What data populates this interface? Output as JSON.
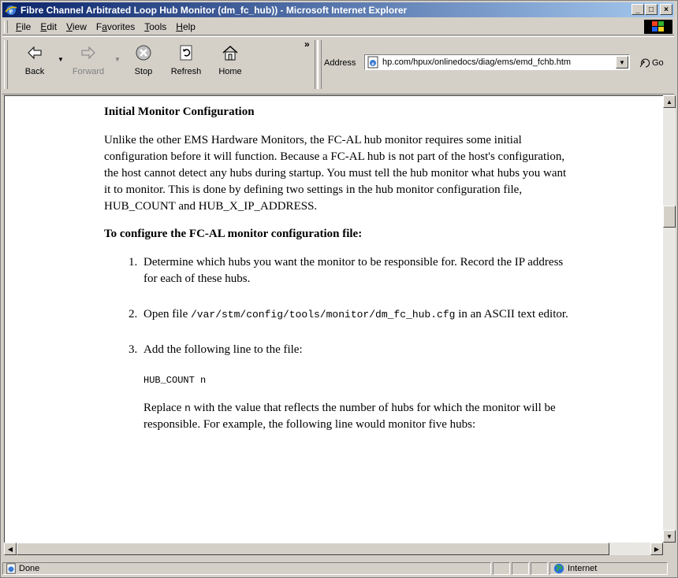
{
  "window": {
    "title": "Fibre Channel Arbitrated Loop Hub Monitor (dm_fc_hub)) - Microsoft Internet Explorer",
    "minimize": "_",
    "maximize": "□",
    "close": "×"
  },
  "menu": {
    "items": [
      {
        "key": "F",
        "rest": "ile"
      },
      {
        "key": "E",
        "rest": "dit"
      },
      {
        "key": "V",
        "rest": "iew"
      },
      {
        "key": "a",
        "pre": "F",
        "rest": "vorites"
      },
      {
        "key": "T",
        "rest": "ools"
      },
      {
        "key": "H",
        "rest": "elp"
      }
    ]
  },
  "toolbar": {
    "back": "Back",
    "forward": "Forward",
    "stop": "Stop",
    "refresh": "Refresh",
    "home": "Home",
    "more": "»",
    "address_label": "Address",
    "address_value": "hp.com/hpux/onlinedocs/diag/ems/emd_fchb.htm",
    "go": "Go"
  },
  "doc": {
    "heading": "Initial Monitor Configuration",
    "intro": "Unlike the other EMS Hardware Monitors, the FC-AL hub monitor requires some initial configuration before it will function. Because a FC-AL hub is not part of the host's configuration, the host cannot detect any hubs during startup. You must tell the hub monitor what hubs you want it to monitor. This is done by defining two settings in the hub monitor configuration file, HUB_COUNT and HUB_X_IP_ADDRESS.",
    "subheading": "To configure the FC-AL monitor configuration file:",
    "steps": {
      "s1": "Determine which hubs you want the monitor to be responsible for. Record the IP address for each of these hubs.",
      "s2_pre": "Open file ",
      "s2_code": "/var/stm/config/tools/monitor/dm_fc_hub.cfg",
      "s2_post": " in an ASCII text editor.",
      "s3": "Add the following line to the file:",
      "s3_code": "HUB_COUNT n",
      "s3_replace_pre": "Replace ",
      "s3_replace_code": "n",
      "s3_replace_post": " with the value that reflects the number of hubs for which the monitor will be responsible. For example, the following line would monitor five hubs:"
    }
  },
  "status": {
    "text": "Done",
    "zone": "Internet"
  }
}
